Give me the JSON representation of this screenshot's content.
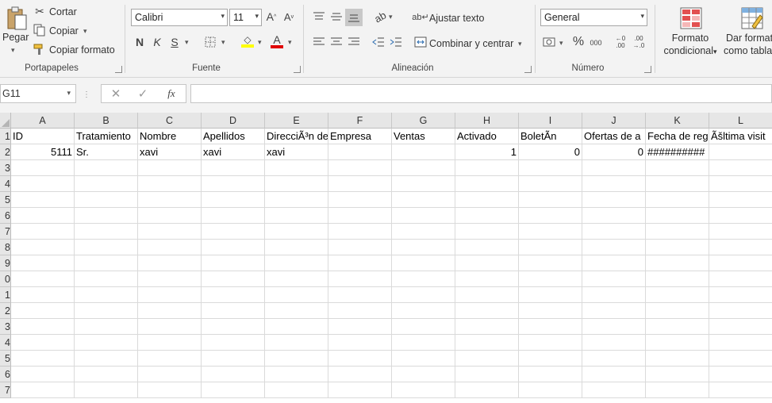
{
  "ribbon": {
    "clipboard": {
      "paste_label": "Pegar",
      "cut_label": "Cortar",
      "copy_label": "Copiar",
      "format_painter_label": "Copiar formato",
      "group_label": "Portapapeles"
    },
    "font": {
      "font_name": "Calibri",
      "font_size": "11",
      "bold": "N",
      "italic": "K",
      "underline": "S",
      "group_label": "Fuente",
      "highlight_color": "#ffff00",
      "font_color": "#e00000"
    },
    "alignment": {
      "wrap_text_label": "Ajustar texto",
      "merge_center_label": "Combinar y centrar",
      "group_label": "Alineación"
    },
    "number": {
      "format_value": "General",
      "percent": "%",
      "thousands": "000",
      "group_label": "Número"
    },
    "styles": {
      "conditional_format_line1": "Formato",
      "conditional_format_line2": "condicional",
      "format_table_line1": "Dar formato",
      "format_table_line2": "como tabla"
    }
  },
  "formula_bar": {
    "name_box": "G11",
    "fx": "fx",
    "formula": ""
  },
  "sheet": {
    "columns": [
      "A",
      "B",
      "C",
      "D",
      "E",
      "F",
      "G",
      "H",
      "I",
      "J",
      "K",
      "L"
    ],
    "row_numbers": [
      "1",
      "2",
      "3",
      "4",
      "5",
      "6",
      "7",
      "8",
      "9",
      "0",
      "1",
      "2",
      "3",
      "4",
      "5",
      "6",
      "7"
    ],
    "rows": [
      [
        "ID",
        "Tratamiento",
        "Nombre",
        "Apellidos",
        "DirecciÃ³n de",
        "Empresa",
        "Ventas",
        "Activado",
        "BoletÃ­n",
        "Ofertas de a",
        "Fecha de reg",
        "Ãšltima visit"
      ],
      [
        "5111",
        "Sr.",
        "xavi",
        "xavi",
        "xavi",
        "",
        "",
        "1",
        "0",
        "0",
        "##########",
        ""
      ]
    ]
  }
}
